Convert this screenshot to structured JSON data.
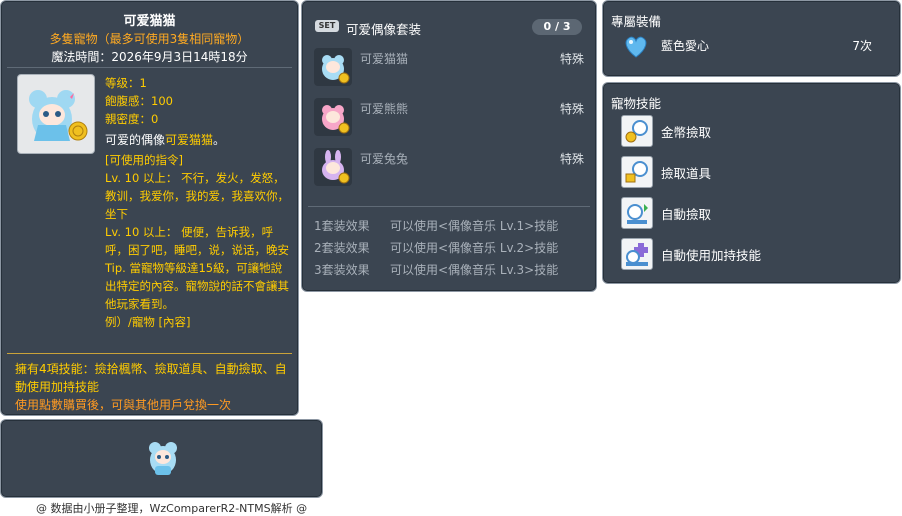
{
  "item_id": "05002735",
  "pet": {
    "name": "可爱猫猫",
    "subtitle": "多隻寵物（最多可使用3隻相同寵物）",
    "expiry": "魔法時間：2026年9月3日14時18分",
    "stats": {
      "level": "等级：1",
      "fullness": "飽腹感：100",
      "closeness": "親密度：0"
    },
    "desc_prefix": "可爱的偶像",
    "desc_highlight": "可爱猫猫",
    "desc_suffix": "。",
    "commands": [
      "[可使用的指令]",
      "Lv. 10 以上： 不行，发火，发怒，教训，我爱你，我的爱，我喜欢你，坐下",
      "Lv. 10 以上： 便便，告诉我，呼呼，困了吧，睡吧，说，说话，晚安",
      "Tip. 當寵物等級達15級，可讓牠說出特定的內容。寵物說的話不會讓其他玩家看到。",
      "例）/寵物 [內容]"
    ],
    "skills_summary": "擁有4項技能：撿拾楓幣、撿取道具、自動撿取、自動使用加持技能",
    "exchange_note": "使用點數購買後，可與其他用戶兌換一次"
  },
  "set_panel": {
    "badge": "SET",
    "title": "可爱偶像套装",
    "count": "0 / 3",
    "items": [
      {
        "name": "可爱猫猫",
        "type": "特殊"
      },
      {
        "name": "可爱熊熊",
        "type": "特殊"
      },
      {
        "name": "可爱兔兔",
        "type": "特殊"
      }
    ],
    "effects": [
      {
        "label": "1套装效果",
        "text": "可以使用<偶像音乐 Lv.1>技能"
      },
      {
        "label": "2套装效果",
        "text": "可以使用<偶像音乐 Lv.2>技能"
      },
      {
        "label": "3套装效果",
        "text": "可以使用<偶像音乐 Lv.3>技能"
      }
    ]
  },
  "equip_panel": {
    "title": "專屬裝備",
    "item_name": "藍色愛心",
    "item_count": "7次"
  },
  "skills_panel": {
    "title": "寵物技能",
    "skills": [
      "金幣撿取",
      "撿取道具",
      "自動撿取",
      "自動使用加持技能"
    ]
  },
  "footer": "@ 数据由小册子整理，WzComparerR2-NTMS解析 @",
  "colors": {
    "panel_bg": "#3b4551",
    "gold": "#ffcc00",
    "orange": "#ffaa22",
    "muted": "#a9b1ba"
  },
  "icons": [
    "pet-cat-icon",
    "pet-bear-icon",
    "pet-rabbit-icon",
    "blue-heart-icon",
    "meso-pickup-icon",
    "item-pickup-icon",
    "auto-pickup-icon",
    "auto-buff-icon"
  ]
}
